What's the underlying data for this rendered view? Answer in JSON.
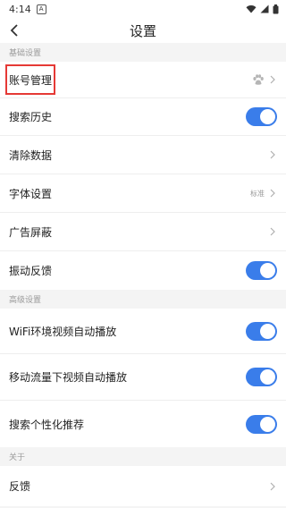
{
  "status_bar": {
    "time": "4:14",
    "notification_badge": "A"
  },
  "nav": {
    "title": "设置"
  },
  "sections": {
    "basic": {
      "header": "基础设置",
      "account": {
        "label": "账号管理",
        "icon": "baidu-paw-icon"
      },
      "search_history": {
        "label": "搜索历史",
        "toggle_on": true
      },
      "clear_data": {
        "label": "清除数据"
      },
      "font": {
        "label": "字体设置",
        "value": "标准"
      },
      "ad_block": {
        "label": "广告屏蔽"
      },
      "vibration": {
        "label": "振动反馈",
        "toggle_on": true
      }
    },
    "advanced": {
      "header": "高级设置",
      "wifi_autoplay": {
        "label": "WiFi环境视频自动播放",
        "toggle_on": true
      },
      "mobile_autoplay": {
        "label": "移动流量下视频自动播放",
        "toggle_on": true
      },
      "personalized": {
        "label": "搜索个性化推荐",
        "toggle_on": true
      }
    },
    "about": {
      "header": "关于",
      "feedback": {
        "label": "反馈"
      }
    }
  },
  "colors": {
    "accent": "#3a7dea",
    "highlight": "#e53935"
  }
}
